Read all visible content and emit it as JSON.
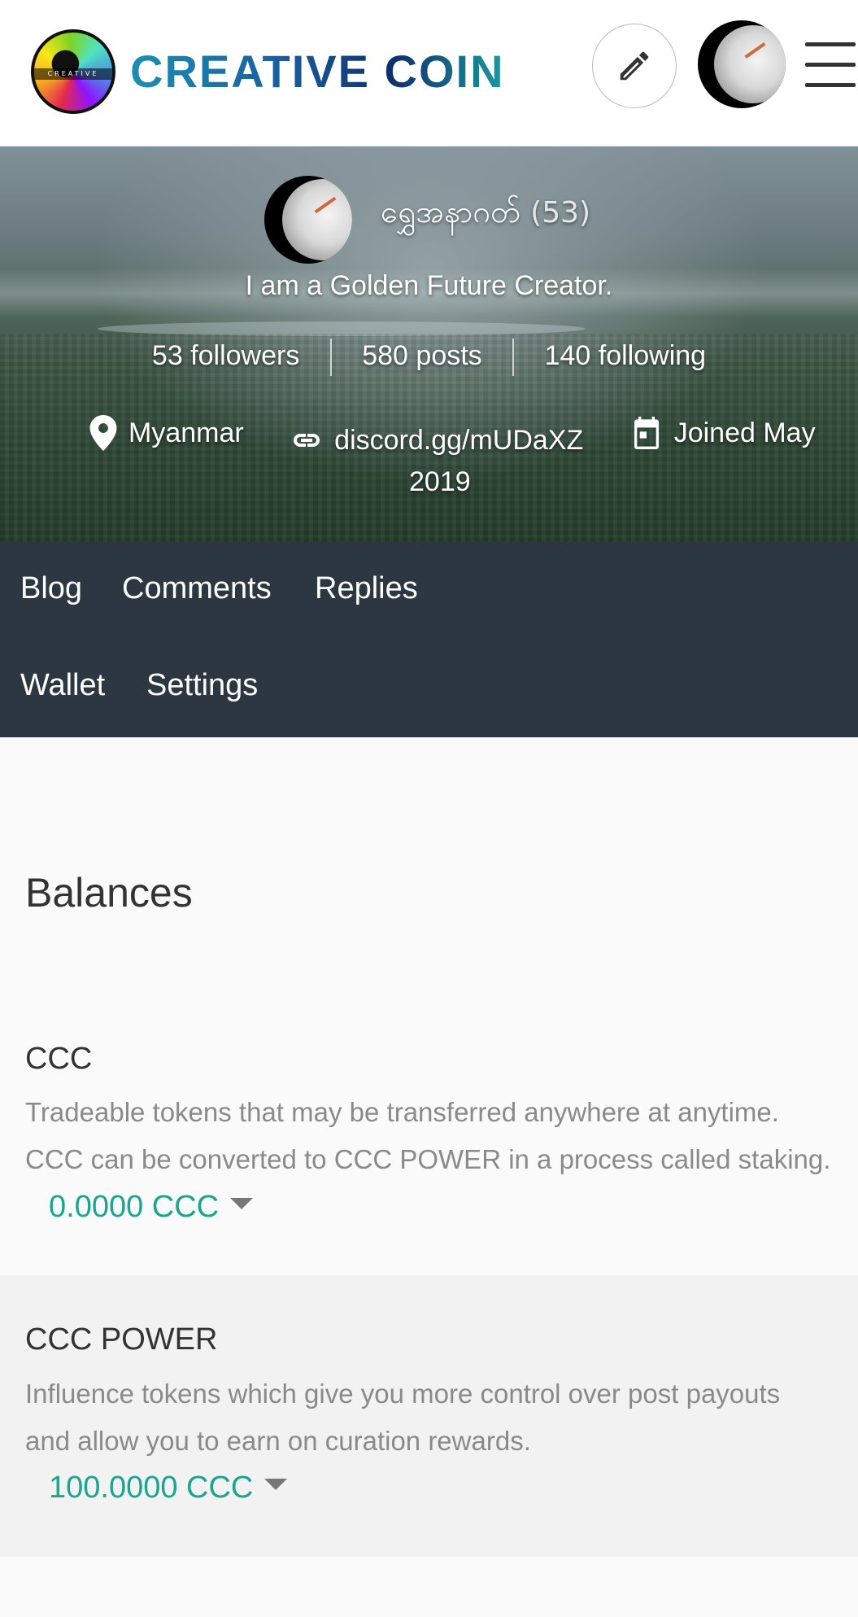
{
  "header": {
    "brand": "CREATIVE COIN",
    "logo_band": "CREATIVE",
    "icons": {
      "pen": "pen-icon",
      "menu": "menu-icon"
    }
  },
  "profile": {
    "name": "ရွှေအနာဂတ်",
    "reputation": "(53)",
    "about": "I am a Golden Future Creator.",
    "followers": "53 followers",
    "posts": "580 posts",
    "following": "140 following",
    "location": "Myanmar",
    "website": "discord.gg/mUDaXZ",
    "joined_line1": "Joined May",
    "joined_line2": "2019"
  },
  "nav": {
    "items": [
      {
        "label": "Blog"
      },
      {
        "label": "Comments"
      },
      {
        "label": "Replies"
      },
      {
        "label": "Wallet"
      },
      {
        "label": "Settings"
      }
    ]
  },
  "wallet": {
    "title": "Balances",
    "rows": [
      {
        "title": "CCC",
        "desc_line1": "Tradeable tokens that may be transferred anywhere at anytime.",
        "desc_line2": "CCC can be converted to CCC POWER in a process called staking.",
        "amount": "0.0000 CCC"
      },
      {
        "title": "CCC POWER",
        "desc_line1": "Influence tokens which give you more control over post payouts",
        "desc_line2": "and allow you to earn on curation rewards.",
        "amount": "100.0000 CCC"
      }
    ]
  },
  "colors": {
    "accent": "#1aa58f",
    "nav_bg": "#2c3742",
    "row_alt": "#f2f2f2"
  }
}
